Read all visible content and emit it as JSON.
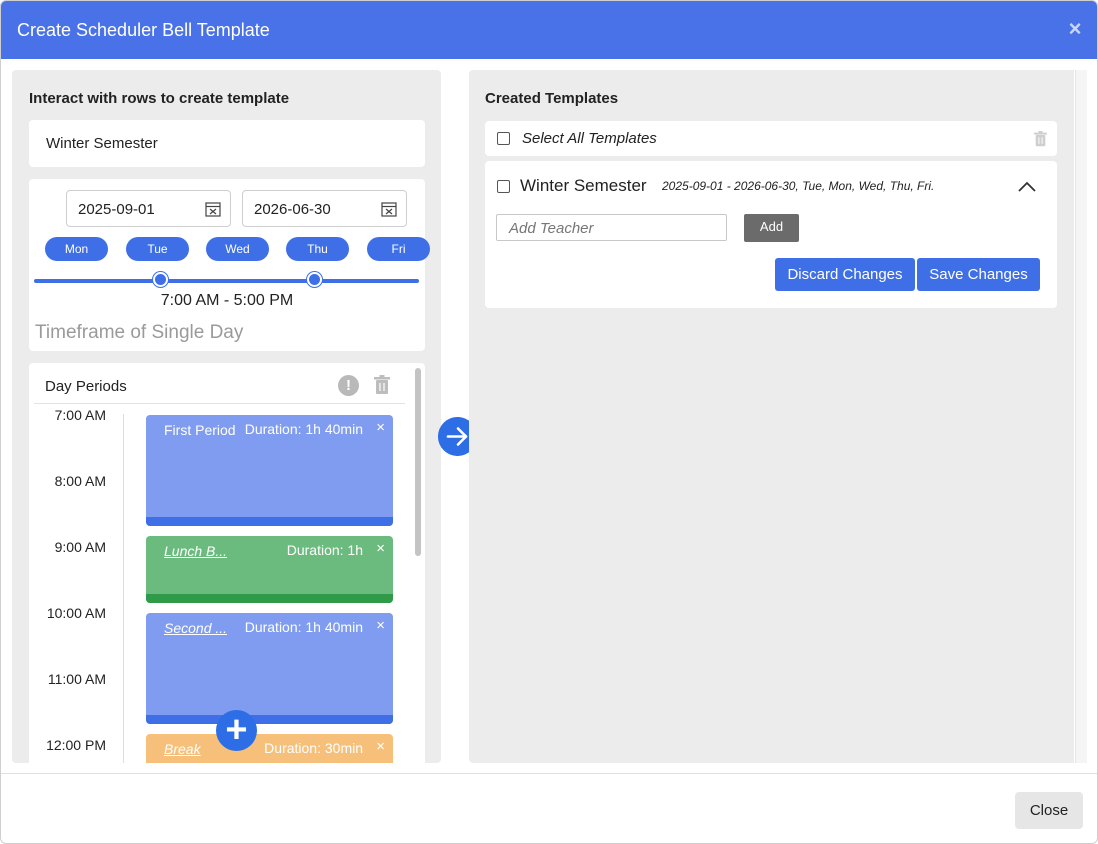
{
  "modal": {
    "title": "Create Scheduler Bell Template"
  },
  "left": {
    "heading": "Interact with rows to create template",
    "template_name": "Winter Semester",
    "start_date": "2025-09-01",
    "end_date": "2026-06-30",
    "days": [
      "Mon",
      "Tue",
      "Wed",
      "Thu",
      "Fri"
    ],
    "time_range": "7:00 AM - 5:00 PM",
    "timeframe_label": "Timeframe of Single Day",
    "periods_title": "Day Periods",
    "info_glyph": "!",
    "add_glyph": "+",
    "time_labels": [
      "7:00 AM",
      "8:00 AM",
      "9:00 AM",
      "10:00 AM",
      "11:00 AM",
      "12:00 PM"
    ],
    "periods": [
      {
        "name": "First Period",
        "duration": "Duration: 1h 40min",
        "color": "#7f9cf0"
      },
      {
        "name": "Lunch B...",
        "duration": "Duration: 1h",
        "color": "#6cbb7e"
      },
      {
        "name": "Second ...",
        "duration": "Duration: 1h 40min",
        "color": "#7f9cf0"
      },
      {
        "name": "Break",
        "duration": "Duration: 30min",
        "color": "#f6c07a"
      }
    ],
    "remove_glyph": "×"
  },
  "right": {
    "heading": "Created Templates",
    "select_all": "Select All Templates",
    "template": {
      "name": "Winter Semester",
      "meta": "2025-09-01 - 2026-06-30, Tue, Mon, Wed, Thu, Fri.",
      "teacher_placeholder": "Add Teacher",
      "add_label": "Add",
      "discard_label": "Discard Changes",
      "save_label": "Save Changes"
    }
  },
  "footer": {
    "close_label": "Close"
  },
  "colors": {
    "header": "#4a72e8",
    "accent": "#3f6fe6",
    "fab": "#2d6ee6"
  },
  "icons": {
    "close": "close-icon",
    "calendar": "calendar-icon",
    "info": "info-icon",
    "trash": "trash-icon",
    "add": "plus-icon",
    "arrow": "arrow-right-icon",
    "chevron": "chevron-up-icon"
  }
}
